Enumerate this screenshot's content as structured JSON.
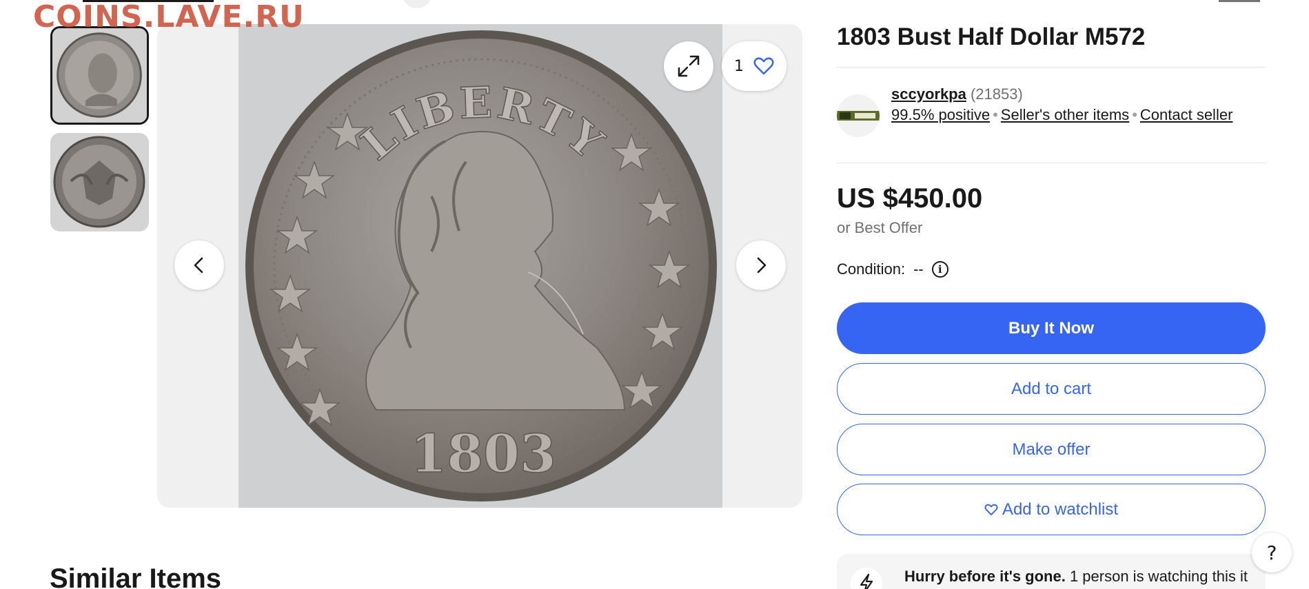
{
  "watermark": "COINS.LAVE.RU",
  "gallery": {
    "watch_count": "1",
    "icons": {
      "prev": "chevron-left-icon",
      "next": "chevron-right-icon",
      "expand": "expand-icon",
      "watch": "heart-icon"
    },
    "coin_obverse": {
      "top_text": "LIBERTY",
      "date": "1803"
    }
  },
  "listing": {
    "title": "1803 Bust Half Dollar M572"
  },
  "seller": {
    "name": "sccyorkpa",
    "feedback_count": "(21853)",
    "positive": "99.5% positive",
    "other_items": "Seller's other items",
    "contact": "Contact seller"
  },
  "price": {
    "amount": "US $450.00",
    "best_offer": "or Best Offer"
  },
  "condition": {
    "label": "Condition:",
    "value": "--"
  },
  "actions": {
    "buy_now": "Buy It Now",
    "add_to_cart": "Add to cart",
    "make_offer": "Make offer",
    "add_to_watchlist": "Add to watchlist"
  },
  "hurry": {
    "bold": "Hurry before it's gone.",
    "text": "1 person is watching this it"
  },
  "help": "?",
  "similar_items": "Similar Items",
  "colors": {
    "primary": "#3665f3",
    "text": "#191919",
    "muted": "#707070",
    "watermark": "#cd4e38"
  }
}
